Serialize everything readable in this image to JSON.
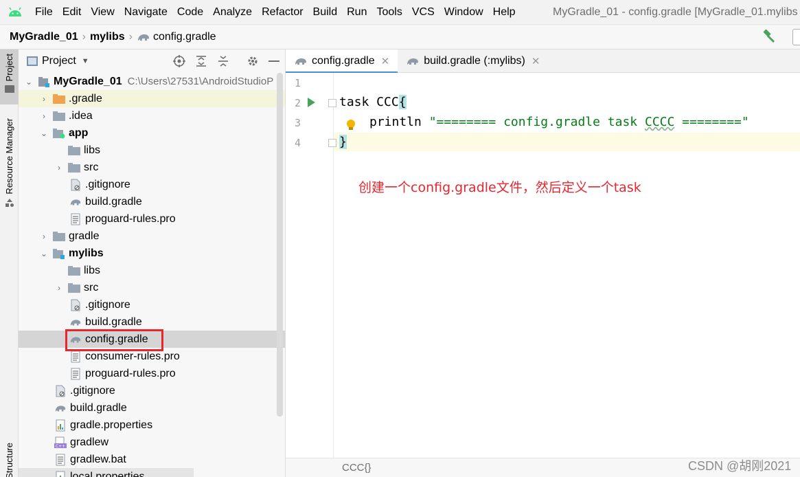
{
  "menubar": {
    "items": [
      "File",
      "Edit",
      "View",
      "Navigate",
      "Code",
      "Analyze",
      "Refactor",
      "Build",
      "Run",
      "Tools",
      "VCS",
      "Window",
      "Help"
    ],
    "window_title": "MyGradle_01 - config.gradle [MyGradle_01.mylibs"
  },
  "navbar": {
    "crumbs": [
      "MyGradle_01",
      "mylibs",
      "config.gradle"
    ]
  },
  "stripe": {
    "project_tab": "Project",
    "resource_manager_tab": "Resource Manager",
    "structure_tab": "Structure"
  },
  "panel": {
    "title": "Project"
  },
  "tree": [
    {
      "label": "MyGradle_01",
      "path": "C:\\Users\\27531\\AndroidStudioP",
      "icon": "module-icon",
      "arrow": "expanded",
      "bold": true
    },
    {
      "label": ".gradle",
      "icon": "folder-orange-icon",
      "arrow": "collapsed"
    },
    {
      "label": ".idea",
      "icon": "folder-icon",
      "arrow": "collapsed"
    },
    {
      "label": "app",
      "icon": "module-folder-icon",
      "arrow": "expanded",
      "bold": true
    },
    {
      "label": "libs",
      "icon": "folder-icon",
      "arrow": "none"
    },
    {
      "label": "src",
      "icon": "folder-icon",
      "arrow": "collapsed"
    },
    {
      "label": ".gitignore",
      "icon": "ignore-file-icon",
      "arrow": "none"
    },
    {
      "label": "build.gradle",
      "icon": "gradle-icon",
      "arrow": "none"
    },
    {
      "label": "proguard-rules.pro",
      "icon": "text-file-icon",
      "arrow": "none"
    },
    {
      "label": "gradle",
      "icon": "folder-icon",
      "arrow": "collapsed"
    },
    {
      "label": "mylibs",
      "icon": "module-folder-icon",
      "arrow": "expanded",
      "bold": true
    },
    {
      "label": "libs",
      "icon": "folder-icon",
      "arrow": "none"
    },
    {
      "label": "src",
      "icon": "folder-icon",
      "arrow": "collapsed"
    },
    {
      "label": ".gitignore",
      "icon": "ignore-file-icon",
      "arrow": "none"
    },
    {
      "label": "build.gradle",
      "icon": "gradle-icon",
      "arrow": "none"
    },
    {
      "label": "config.gradle",
      "icon": "gradle-icon",
      "arrow": "none",
      "selected": true
    },
    {
      "label": "consumer-rules.pro",
      "icon": "text-file-icon",
      "arrow": "none"
    },
    {
      "label": "proguard-rules.pro",
      "icon": "text-file-icon",
      "arrow": "none"
    },
    {
      "label": ".gitignore",
      "icon": "ignore-file-icon",
      "arrow": "none"
    },
    {
      "label": "build.gradle",
      "icon": "gradle-icon",
      "arrow": "none"
    },
    {
      "label": "gradle.properties",
      "icon": "properties-file-icon",
      "arrow": "none"
    },
    {
      "label": "gradlew",
      "icon": "cpp-file-icon",
      "arrow": "none"
    },
    {
      "label": "gradlew.bat",
      "icon": "text-file-icon",
      "arrow": "none"
    },
    {
      "label": "local.properties",
      "icon": "properties-file-icon",
      "arrow": "none"
    }
  ],
  "tabs": [
    {
      "label": "config.gradle",
      "active": true
    },
    {
      "label": "build.gradle (:mylibs)",
      "active": false
    }
  ],
  "editor": {
    "line_numbers": [
      "1",
      "2",
      "3",
      "4"
    ],
    "line2_keyword": "task CCC",
    "line2_brace": "{",
    "line3_prefix": "println ",
    "line3_string_a": "\"======== config.gradle task ",
    "line3_string_b": "CCCC",
    "line3_string_c": " ========\"",
    "line4_brace": "}",
    "annotation": "创建一个config.gradle文件，然后定义一个task"
  },
  "statusbar": {
    "code_crumb": "CCC{}"
  },
  "watermark": "CSDN @胡刚2021",
  "colors": {
    "accent_blue": "#4a8dd8",
    "annotation_red": "#e8262e",
    "string_green": "#067d17",
    "run_green": "#4aa35a"
  }
}
